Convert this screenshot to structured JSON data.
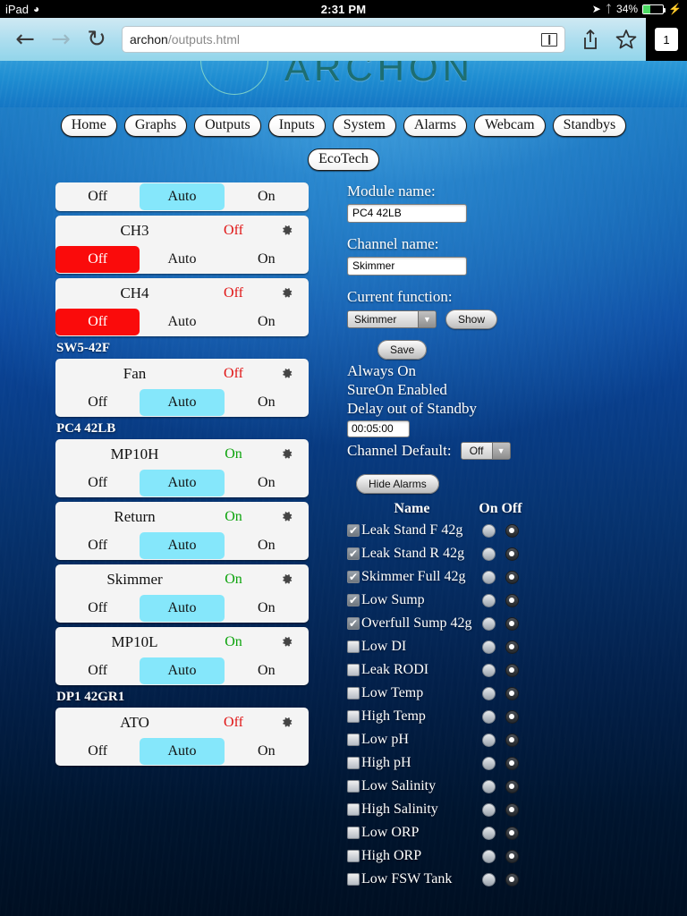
{
  "status_bar": {
    "device": "iPad",
    "wifi_icon": "wifi-icon",
    "time": "2:31 PM",
    "location_icon": "location-arrow-icon",
    "bluetooth_icon": "bluetooth-icon",
    "battery_percent": "34%",
    "battery_level": 34,
    "charging": true
  },
  "browser": {
    "back_icon": "back-arrow-icon",
    "forward_icon": "forward-arrow-icon",
    "reload_icon": "reload-icon",
    "url_host": "archon",
    "url_path": "/outputs.html",
    "reader_icon": "reader-view-icon",
    "share_icon": "share-icon",
    "bookmark_icon": "bookmark-star-icon",
    "tab_count": "1"
  },
  "site": {
    "logo_text": "ARCHON",
    "nav_primary": [
      "Home",
      "Graphs",
      "Outputs",
      "Inputs",
      "System",
      "Alarms",
      "Webcam",
      "Standbys"
    ],
    "nav_secondary": [
      "EcoTech"
    ]
  },
  "outputs": {
    "mode_labels": {
      "off": "Off",
      "auto": "Auto",
      "on": "On"
    },
    "gear_icon": "gear-icon",
    "groups": [
      {
        "label": null,
        "channels": [
          {
            "name": null,
            "state": null,
            "state_class": null,
            "selected_mode": "auto",
            "clipped_top": true
          },
          {
            "name": "CH3",
            "state": "Off",
            "state_class": "off",
            "selected_mode": "off",
            "clipped_top": false
          },
          {
            "name": "CH4",
            "state": "Off",
            "state_class": "off",
            "selected_mode": "off",
            "clipped_top": false
          }
        ]
      },
      {
        "label": "SW5-42F",
        "channels": [
          {
            "name": "Fan",
            "state": "Off",
            "state_class": "off",
            "selected_mode": "auto",
            "clipped_top": false
          }
        ]
      },
      {
        "label": "PC4 42LB",
        "channels": [
          {
            "name": "MP10H",
            "state": "On",
            "state_class": "on",
            "selected_mode": "auto",
            "clipped_top": false
          },
          {
            "name": "Return",
            "state": "On",
            "state_class": "on",
            "selected_mode": "auto",
            "clipped_top": false
          },
          {
            "name": "Skimmer",
            "state": "On",
            "state_class": "on",
            "selected_mode": "auto",
            "clipped_top": false
          },
          {
            "name": "MP10L",
            "state": "On",
            "state_class": "on",
            "selected_mode": "auto",
            "clipped_top": false
          }
        ]
      },
      {
        "label": "DP1 42GR1",
        "channels": [
          {
            "name": "ATO",
            "state": "Off",
            "state_class": "off",
            "selected_mode": "auto",
            "clipped_top": false
          }
        ]
      }
    ]
  },
  "settings": {
    "module_name_label": "Module name:",
    "module_name_value": "PC4 42LB",
    "channel_name_label": "Channel name:",
    "channel_name_value": "Skimmer",
    "current_function_label": "Current function:",
    "current_function_value": "Skimmer",
    "show_button": "Show",
    "save_button": "Save",
    "always_on_label": "Always On",
    "sureon_label": "SureOn Enabled",
    "delay_standby_label": "Delay out of Standby",
    "delay_standby_value": "00:05:00",
    "channel_default_label": "Channel Default:",
    "channel_default_value": "Off",
    "hide_alarms_button": "Hide Alarms",
    "dropdown_icon": "chevron-down-icon"
  },
  "alarms": {
    "header": {
      "name": "Name",
      "on": "On",
      "off": "Off"
    },
    "check_glyph": "✔",
    "rows": [
      {
        "name": "Leak Stand F 42g",
        "checked": true,
        "on": false,
        "off": true
      },
      {
        "name": "Leak Stand R 42g",
        "checked": true,
        "on": false,
        "off": true
      },
      {
        "name": "Skimmer Full 42g",
        "checked": true,
        "on": false,
        "off": true
      },
      {
        "name": "Low Sump",
        "checked": true,
        "on": false,
        "off": true
      },
      {
        "name": "Overfull Sump 42g",
        "checked": true,
        "on": false,
        "off": true
      },
      {
        "name": "Low DI",
        "checked": false,
        "on": false,
        "off": true
      },
      {
        "name": "Leak RODI",
        "checked": false,
        "on": false,
        "off": true
      },
      {
        "name": "Low Temp",
        "checked": false,
        "on": false,
        "off": true
      },
      {
        "name": "High Temp",
        "checked": false,
        "on": false,
        "off": true
      },
      {
        "name": "Low pH",
        "checked": false,
        "on": false,
        "off": true
      },
      {
        "name": "High pH",
        "checked": false,
        "on": false,
        "off": true
      },
      {
        "name": "Low Salinity",
        "checked": false,
        "on": false,
        "off": true
      },
      {
        "name": "High Salinity",
        "checked": false,
        "on": false,
        "off": true
      },
      {
        "name": "Low ORP",
        "checked": false,
        "on": false,
        "off": true
      },
      {
        "name": "High ORP",
        "checked": false,
        "on": false,
        "off": true
      },
      {
        "name": "Low FSW Tank",
        "checked": false,
        "on": false,
        "off": true
      }
    ]
  },
  "colors": {
    "auto_selected": "#85e7fb",
    "off_selected": "#fa0b0b",
    "state_on": "#0ca30c",
    "state_off": "#e01414",
    "page_bg_top": "#1a7fc6",
    "page_bg_bottom": "#000f22",
    "battery_green": "#4cd964"
  }
}
